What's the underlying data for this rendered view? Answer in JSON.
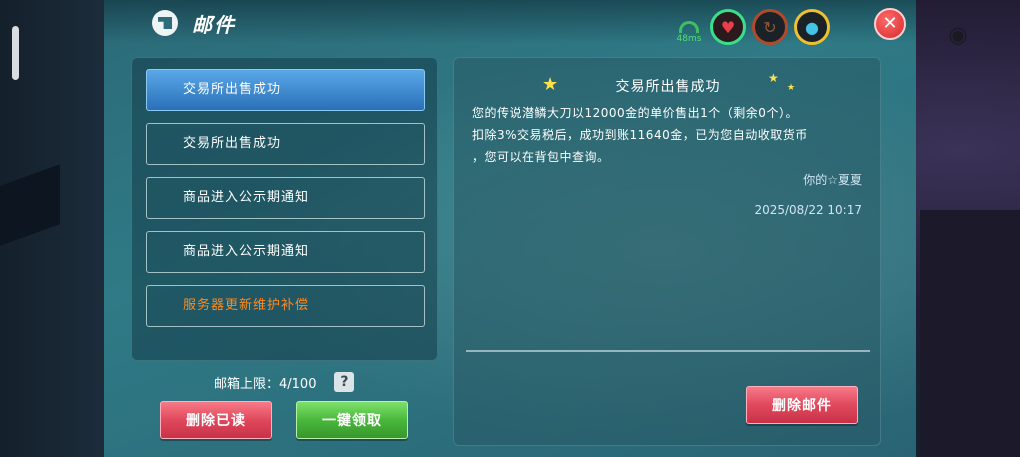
{
  "window": {
    "title": "邮件"
  },
  "status": {
    "signal_text": "48ms"
  },
  "mail_list": {
    "items": [
      {
        "label": "交易所出售成功",
        "state": "selected"
      },
      {
        "label": "交易所出售成功",
        "state": "normal"
      },
      {
        "label": "商品进入公示期通知",
        "state": "normal"
      },
      {
        "label": "商品进入公示期通知",
        "state": "normal"
      },
      {
        "label": "服务器更新维护补偿",
        "state": "highlight"
      }
    ]
  },
  "mailbox": {
    "limit_label": "邮箱上限：4/100",
    "help": "?"
  },
  "actions": {
    "delete_read": "删除已读",
    "claim_all": "一键领取",
    "delete_mail": "删除邮件"
  },
  "detail": {
    "title": "交易所出售成功",
    "body_line1": "您的传说潜鳞大刀以12000金的单价售出1个（剩余0个）。",
    "body_line2": "扣除3%交易税后，成功到账11640金，已为您自动收取货币",
    "body_line3": "，您可以在背包中查询。",
    "sender": "你的☆夏夏",
    "timestamp": "2025/08/22 10:17"
  },
  "colors": {
    "accent_selected": "#3a88d0",
    "highlight_text": "#ff8a1e",
    "red_button": "#e0485c",
    "green_button": "#4ab83c",
    "close_button": "#d42a2a"
  },
  "icons": [
    "mail-icon",
    "wifi-icon",
    "heart-icon",
    "power-icon",
    "water-drop-icon",
    "close-icon",
    "help-icon",
    "eye-icon",
    "star-icon"
  ]
}
